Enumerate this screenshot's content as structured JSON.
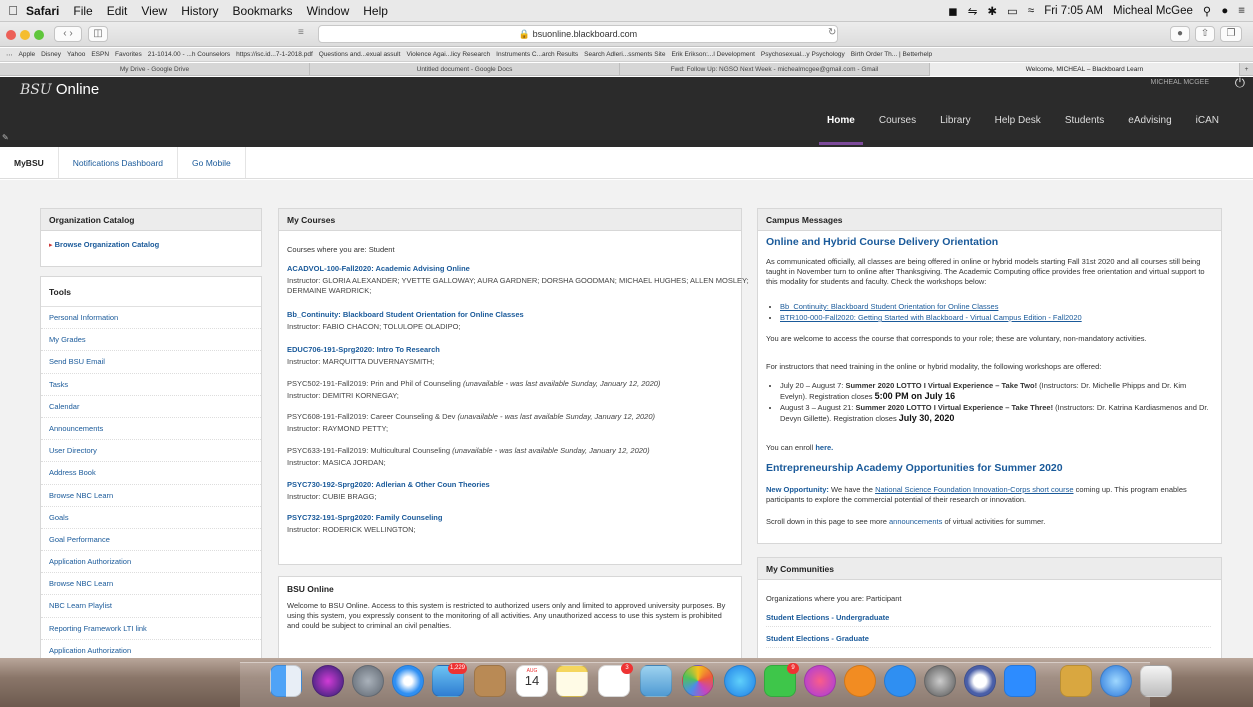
{
  "menubar": {
    "app": "Safari",
    "items": [
      "File",
      "Edit",
      "View",
      "History",
      "Bookmarks",
      "Window",
      "Help"
    ],
    "datetime": "Fri 7:05 AM",
    "user": "Micheal McGee"
  },
  "browser": {
    "url": "bsuonline.blackboard.com",
    "bookmarks": [
      "Apple",
      "Disney",
      "Yahoo",
      "ESPN",
      "Favorites",
      "21-1014.00 - ...h Counselors",
      "https://isc.id...7-1-2018.pdf",
      "Questions and...exual assult",
      "Violence Agai...licy Research",
      "Instruments C...arch Results",
      "Search Adleri...ssments Site",
      "Erik Erikson:...l Development",
      "Psychosexual...y Psychology",
      "Birth Order Th... | Betterhelp"
    ],
    "tabs": [
      "My Drive - Google Drive",
      "Untitled document - Google Docs",
      "Fwd: Follow Up: NGSO Next Week - michealmcgee@gmail.com - Gmail",
      "Welcome, MICHEAL – Blackboard Learn"
    ]
  },
  "site": {
    "logo_prefix": "BSU",
    "logo_text": "Online",
    "user_label": "MICHEAL MCGEE",
    "nav": [
      "Home",
      "Courses",
      "Library",
      "Help Desk",
      "Students",
      "eAdvising",
      "iCAN"
    ]
  },
  "subtabs": [
    "MyBSU",
    "Notifications Dashboard",
    "Go Mobile"
  ],
  "org_catalog": {
    "title": "Organization Catalog",
    "link": "Browse Organization Catalog"
  },
  "tools": {
    "title": "Tools",
    "items": [
      "Personal Information",
      "My Grades",
      "Send BSU Email",
      "Tasks",
      "Calendar",
      "Announcements",
      "User Directory",
      "Address Book",
      "Browse NBC Learn",
      "Goals",
      "Goal Performance",
      "Application Authorization",
      "Browse NBC Learn",
      "NBC Learn Playlist",
      "Reporting Framework LTI link",
      "Application Authorization"
    ]
  },
  "my_courses": {
    "title": "My Courses",
    "role_text": "Courses where you are: Student",
    "courses": [
      {
        "title": "ACADVOL-100-Fall2020: Academic Advising Online",
        "status": "",
        "instructor": "Instructor: GLORIA ALEXANDER;  YVETTE GALLOWAY;  AURA GARDNER;  DORSHA GOODMAN;  MICHAEL HUGHES;  ALLEN MOSLEY;  DERMAINE WARDRICK;"
      },
      {
        "title": "Bb_Continuity: Blackboard Student Orientation for Online Classes",
        "status": "",
        "instructor": "Instructor: FABIO CHACON;  TOLULOPE OLADIPO;"
      },
      {
        "title": "EDUC706-191-Sprg2020: Intro To Research",
        "status": "",
        "instructor": "Instructor: MARQUITTA DUVERNAYSMITH;"
      },
      {
        "title": "PSYC502-191-Fall2019: Prin and Phil of Counseling",
        "status": "(unavailable - was last available Sunday, January 12, 2020)",
        "instructor": "Instructor: DEMITRI KORNEGAY;"
      },
      {
        "title": "PSYC608-191-Fall2019: Career Counseling & Dev",
        "status": "(unavailable - was last available Sunday, January 12, 2020)",
        "instructor": "Instructor: RAYMOND PETTY;"
      },
      {
        "title": "PSYC633-191-Fall2019: Multicultural Counseling",
        "status": "(unavailable - was last available Sunday, January 12, 2020)",
        "instructor": "Instructor: MASICA JORDAN;"
      },
      {
        "title": "PSYC730-192-Sprg2020: Adlerian & Other Coun Theories",
        "status": "",
        "instructor": "Instructor: CUBIE BRAGG;"
      },
      {
        "title": "PSYC732-191-Sprg2020: Family Counseling",
        "status": "",
        "instructor": "Instructor: RODERICK WELLINGTON;"
      }
    ]
  },
  "bsu_online": {
    "title": "BSU Online",
    "text": "Welcome to BSU Online. Access to this system is restricted to authorized users only and limited to approved university purposes. By using this system, you expressly consent to the monitoring of all activities. Any unauthorized access to use this system is prohibited and could be subject to criminal an civil penalties."
  },
  "campus": {
    "title": "Campus Messages",
    "heading1": "Online and Hybrid Course Delivery Orientation",
    "p1": "As communicated officially, all classes are being offered in online or hybrid models starting Fall 31st 2020 and all courses still being taught in November turn to online after Thanksgiving. The Academic Computing office provides free orientation and virtual support to this modality for students and faculty. Check the workshops below:",
    "links": [
      "Bb_Continuity: Blackboard Student Orientation for Online Classes",
      "BTR100-000-Fall2020: Getting Started with Blackboard - Virtual Campus Edition - Fall2020"
    ],
    "p2": "You are welcome to access the course that corresponds to your role; these are voluntary, non-mandatory activities.",
    "p3": "For instructors that need training in the online or hybrid modality, the following workshops are offered:",
    "w1_pre": "July 20 – August 7: ",
    "w1_title": "Summer 2020 LOTTO I Virtual Experience – Take Two!",
    "w1_mid": " (Instructors: Dr. Michelle Phipps and Dr. Kim Evelyn). Registration closes ",
    "w1_date": "5:00 PM on July 16",
    "w2_pre": "August 3 – August 21: ",
    "w2_title": "Summer 2020 LOTTO I Virtual Experience – Take Three!",
    "w2_mid": " (Instructors: Dr. Katrina Kardiasmenos and Dr. Devyn Gillette). Registration closes ",
    "w2_date": "July 30, 2020",
    "enroll_pre": "You can enroll ",
    "enroll_link": "here.",
    "heading2": "Entrepreneurship Academy Opportunities for Summer 2020",
    "opp_label": "New Opportunity:",
    "opp_pre": " We have the ",
    "opp_link": "National Science Foundation Innovation-Corps short course",
    "opp_post": "  coming up. This program enables participants to explore the commercial potential of their research or innovation.",
    "scroll_pre": "Scroll down in this page to see more ",
    "scroll_link": "announcements",
    "scroll_post": " of virtual activities for summer."
  },
  "communities": {
    "title": "My Communities",
    "role_text": "Organizations where you are: Participant",
    "items": [
      "Student Elections - Undergraduate",
      "Student Elections - Graduate"
    ]
  },
  "dock": {
    "badges": {
      "photos": "1,229",
      "calendar_month": "AUG",
      "calendar_day": "14",
      "reminders": "3",
      "facetime": "9"
    }
  }
}
